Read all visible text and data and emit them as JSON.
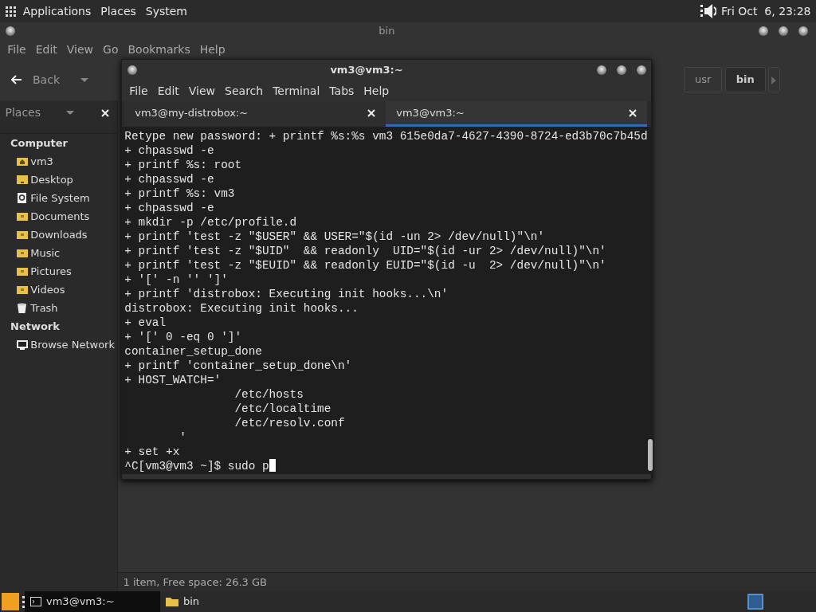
{
  "top_panel": {
    "menus": [
      "Applications",
      "Places",
      "System"
    ],
    "clock": "Fri Oct  6, 23:28"
  },
  "file_manager": {
    "title": "bin",
    "menu": [
      "File",
      "Edit",
      "View",
      "Go",
      "Bookmarks",
      "Help"
    ],
    "back_label": "Back",
    "path": [
      {
        "label": "usr",
        "selected": false
      },
      {
        "label": "bin",
        "selected": true
      }
    ],
    "sidebar": {
      "title": "Places",
      "sections": [
        {
          "heading": "Computer",
          "items": [
            {
              "label": "vm3",
              "kind": "home"
            },
            {
              "label": "Desktop",
              "kind": "desktop"
            },
            {
              "label": "File System",
              "kind": "drive"
            },
            {
              "label": "Documents",
              "kind": "folder"
            },
            {
              "label": "Downloads",
              "kind": "folder"
            },
            {
              "label": "Music",
              "kind": "folder"
            },
            {
              "label": "Pictures",
              "kind": "folder"
            },
            {
              "label": "Videos",
              "kind": "folder"
            },
            {
              "label": "Trash",
              "kind": "trash"
            }
          ]
        },
        {
          "heading": "Network",
          "items": [
            {
              "label": "Browse Network",
              "kind": "network"
            }
          ]
        }
      ]
    },
    "status": "1 item, Free space: 26.3 GB"
  },
  "terminal": {
    "title": "vm3@vm3:~",
    "menu": [
      "File",
      "Edit",
      "View",
      "Search",
      "Terminal",
      "Tabs",
      "Help"
    ],
    "tabs": [
      {
        "label": "vm3@my-distrobox:~",
        "selected": false
      },
      {
        "label": "vm3@vm3:~",
        "selected": true
      }
    ],
    "lines": [
      "Retype new password: + printf %s:%s vm3 615e0da7-4627-4390-8724-ed3b70c7b45d",
      "+ chpasswd -e",
      "+ printf %s: root",
      "+ chpasswd -e",
      "+ printf %s: vm3",
      "+ chpasswd -e",
      "+ mkdir -p /etc/profile.d",
      "+ printf 'test -z \"$USER\" && USER=\"$(id -un 2> /dev/null)\"\\n'",
      "+ printf 'test -z \"$UID\"  && readonly  UID=\"$(id -ur 2> /dev/null)\"\\n'",
      "+ printf 'test -z \"$EUID\" && readonly EUID=\"$(id -u  2> /dev/null)\"\\n'",
      "+ '[' -n '' ']'",
      "+ printf 'distrobox: Executing init hooks...\\n'",
      "distrobox: Executing init hooks...",
      "+ eval",
      "+ '[' 0 -eq 0 ']'",
      "container_setup_done",
      "+ printf 'container_setup_done\\n'",
      "+ HOST_WATCH='",
      "                /etc/hosts",
      "                /etc/localtime",
      "                /etc/resolv.conf",
      "        '",
      "+ set +x",
      "^C[vm3@vm3 ~]$ sudo p"
    ]
  },
  "taskbar": {
    "tasks": [
      {
        "label": "vm3@vm3:~",
        "kind": "terminal",
        "selected": true
      },
      {
        "label": "bin",
        "kind": "folder",
        "selected": false
      }
    ]
  }
}
